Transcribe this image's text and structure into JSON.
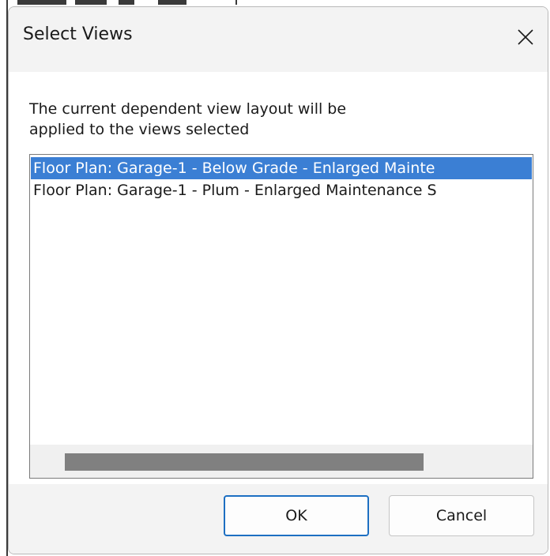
{
  "dialog": {
    "title": "Select Views",
    "close_icon": "close-icon",
    "message": "The current dependent view layout will be\napplied to the views selected",
    "views": [
      {
        "label": "Floor Plan: Garage-1 - Below Grade - Enlarged Mainte",
        "selected": true
      },
      {
        "label": "Floor Plan: Garage-1 - Plum - Enlarged Maintenance S",
        "selected": false
      }
    ],
    "ok_label": "OK",
    "cancel_label": "Cancel"
  },
  "colors": {
    "selection": "#3b7fd4",
    "primary_border": "#1d6fc2",
    "chrome": "#f3f3f3"
  }
}
